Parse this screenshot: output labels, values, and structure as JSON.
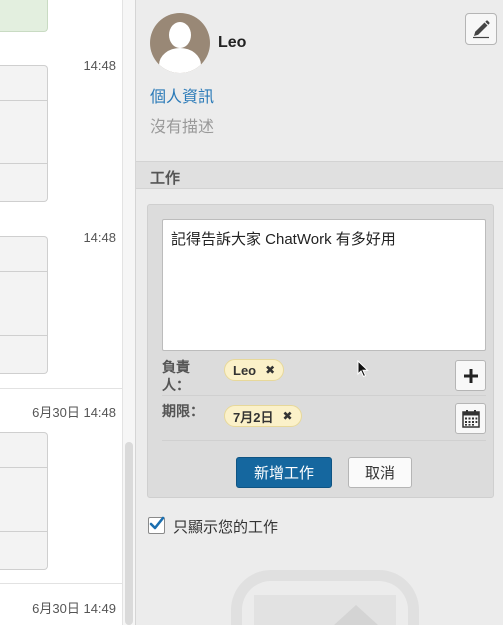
{
  "chat": {
    "timestamps": [
      "14:48",
      "14:48",
      "6月30日 14:48",
      "6月30日 14:49"
    ]
  },
  "profile": {
    "name": "Leo",
    "profile_link": "個人資訊",
    "description": "沒有描述"
  },
  "task_section": {
    "title": "工作",
    "content": "記得告訴大家 ChatWork 有多好用",
    "assignee_label": "負責人：",
    "assignee_chip": "Leo",
    "deadline_label": "期限：",
    "deadline_chip": "7月2日",
    "remove_glyph": "✖",
    "add_button": "新增工作",
    "cancel_button": "取消"
  },
  "filter": {
    "label": "只顯示您的工作",
    "checked": true
  },
  "colors": {
    "primary_button": "#15679f",
    "link": "#2a7ab8",
    "chip_bg": "#fbf1c9"
  },
  "icons": [
    "pencil-icon",
    "plus-icon",
    "calendar-icon",
    "checkmark-icon",
    "user-avatar-icon"
  ]
}
